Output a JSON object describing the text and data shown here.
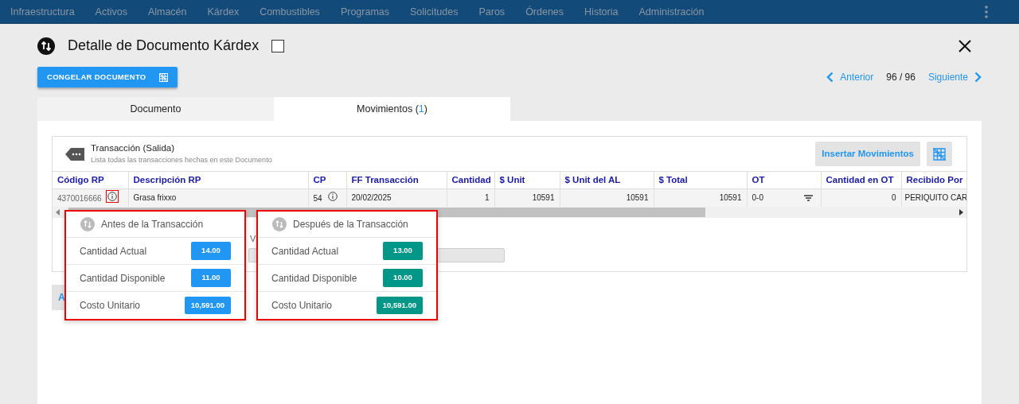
{
  "nav": {
    "items": [
      "Infraestructura",
      "Activos",
      "Almacén",
      "Kárdex",
      "Combustibles",
      "Programas",
      "Solicitudes",
      "Paros",
      "Órdenes",
      "Historia",
      "Administración"
    ]
  },
  "header": {
    "title": "Detalle de Documento Kárdex",
    "checked": false
  },
  "freeze_button": "CONGELAR DOCUMENTO",
  "pager": {
    "previous": "Anterior",
    "position": "96 / 96",
    "next": "Siguiente"
  },
  "tabs": [
    {
      "label": "Documento",
      "selected": false
    },
    {
      "label": "Movimientos (",
      "count": "1",
      "after": ")",
      "selected": true
    }
  ],
  "panel": {
    "title": "Transacción (Salida)",
    "subtitle": "Lista todas las transacciones hechas en este Documento",
    "insert_button": "Insertar Movimientos"
  },
  "table": {
    "columns": [
      "Código RP",
      "Descripción RP",
      "CP",
      "FF Transacción",
      "Cantidad",
      "$ Unit",
      "$ Unit del AL",
      "$ Total",
      "OT",
      "Cantidad en OT",
      "Recibido Por"
    ],
    "rows": [
      {
        "cells": [
          {
            "kind": "info",
            "text": "4370016666",
            "highlighted": true
          },
          {
            "kind": "text",
            "text": "Grasa frixxo"
          },
          {
            "kind": "info",
            "text": "54",
            "highlighted": false
          },
          {
            "kind": "text",
            "text": "20/02/2025"
          },
          {
            "kind": "number",
            "text": "1"
          },
          {
            "kind": "number",
            "text": "10591"
          },
          {
            "kind": "number",
            "text": "10591"
          },
          {
            "kind": "number",
            "text": "10591"
          },
          {
            "kind": "filter",
            "text": "0-0"
          },
          {
            "kind": "number",
            "text": "0"
          },
          {
            "kind": "text",
            "text": "PERIQUITO CAR"
          }
        ]
      }
    ]
  },
  "hidden_label": "V",
  "progress": {
    "level": 0
  },
  "hidden_button": "A",
  "popovers": [
    {
      "title": "Antes de la Transacción",
      "highlighted": true,
      "color": "#2196f3",
      "items": [
        {
          "label": "Cantidad Actual",
          "value": "14.00"
        },
        {
          "label": "Cantidad Disponible",
          "value": "11.00"
        },
        {
          "label": "Costo Unitario",
          "value": "10,591.00"
        }
      ]
    },
    {
      "title": "Después de la Transacción",
      "highlighted": true,
      "color": "#009688",
      "items": [
        {
          "label": "Cantidad Actual",
          "value": "13.00"
        },
        {
          "label": "Cantidad Disponible",
          "value": "10.00"
        },
        {
          "label": "Costo Unitario",
          "value": "10,591.00"
        }
      ]
    }
  ]
}
